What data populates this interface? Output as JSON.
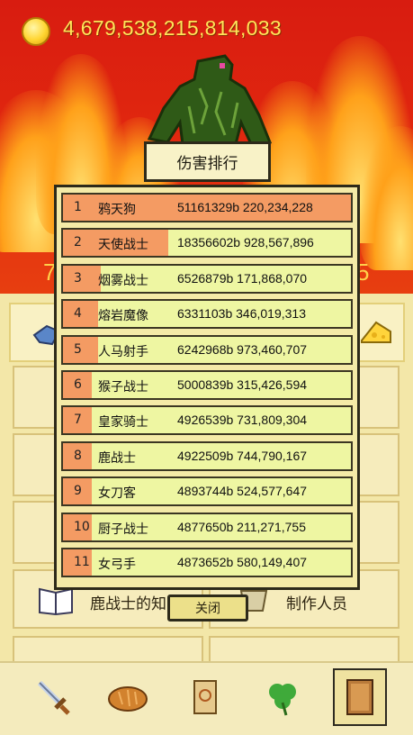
{
  "header": {
    "gold_amount": "4,679,538,215,814,033",
    "coin_icon": "gold-coin-icon"
  },
  "behind": {
    "left_number_fragment": "7",
    "right_number_fragment": "5"
  },
  "panel": {
    "knowledge_label": "鹿战士的知",
    "credits_label": "制作人员"
  },
  "popup": {
    "title": "伤害排行",
    "close_label": "关闭",
    "rows": [
      {
        "rank": "1",
        "name": "鸦天狗",
        "value": "51161329b 220,234,228",
        "share": 1.0
      },
      {
        "rank": "2",
        "name": "天使战士",
        "value": "18356602b 928,567,896",
        "share": 0.36
      },
      {
        "rank": "3",
        "name": "烟雾战士",
        "value": "6526879b 171,868,070",
        "share": 0.13
      },
      {
        "rank": "4",
        "name": "熔岩魔像",
        "value": "6331103b 346,019,313",
        "share": 0.12
      },
      {
        "rank": "5",
        "name": "人马射手",
        "value": "6242968b 973,460,707",
        "share": 0.12
      },
      {
        "rank": "6",
        "name": "猴子战士",
        "value": "5000839b 315,426,594",
        "share": 0.1
      },
      {
        "rank": "7",
        "name": "皇家骑士",
        "value": "4926539b 731,809,304",
        "share": 0.1
      },
      {
        "rank": "8",
        "name": "鹿战士",
        "value": "4922509b 744,790,167",
        "share": 0.1
      },
      {
        "rank": "9",
        "name": "女刀客",
        "value": "4893744b 524,577,647",
        "share": 0.1
      },
      {
        "rank": "10",
        "name": "厨子战士",
        "value": "4877650b 211,271,755",
        "share": 0.1
      },
      {
        "rank": "11",
        "name": "女弓手",
        "value": "4873652b 580,149,407",
        "share": 0.1
      }
    ]
  },
  "nav": {
    "items": [
      {
        "icon": "sword-icon"
      },
      {
        "icon": "bread-icon"
      },
      {
        "icon": "scroll-icon"
      },
      {
        "icon": "clover-icon"
      },
      {
        "icon": "book-icon",
        "active": true
      }
    ]
  }
}
